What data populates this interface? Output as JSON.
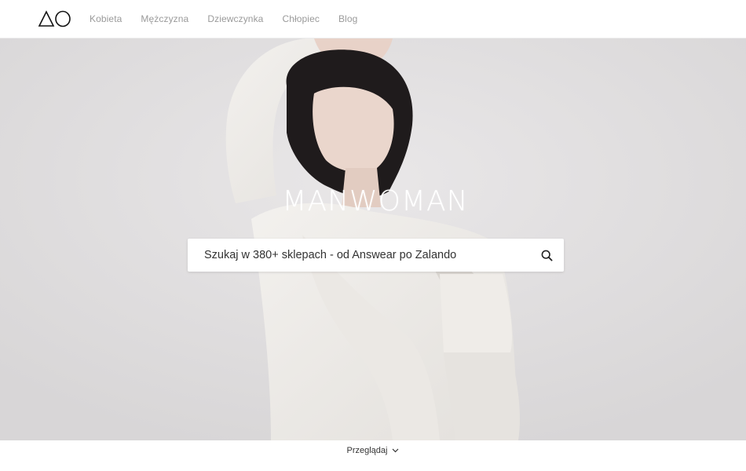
{
  "header": {
    "logo_alt": "ΔO",
    "nav": [
      {
        "label": "Kobieta"
      },
      {
        "label": "Mężczyzna"
      },
      {
        "label": "Dziewczynka"
      },
      {
        "label": "Chłopiec"
      },
      {
        "label": "Blog"
      }
    ]
  },
  "hero": {
    "brand": "MANWOMAN",
    "image_icon": "fashion-model-photo",
    "search": {
      "placeholder": "Szukaj w 380+ sklepach - od Answear po Zalando",
      "value": "",
      "icon": "search-icon"
    }
  },
  "browse": {
    "label": "Przeglądaj",
    "icon": "chevron-down-icon"
  },
  "colors": {
    "background": "#dedcdd",
    "nav_text": "#9a9a9a",
    "text": "#333333"
  }
}
